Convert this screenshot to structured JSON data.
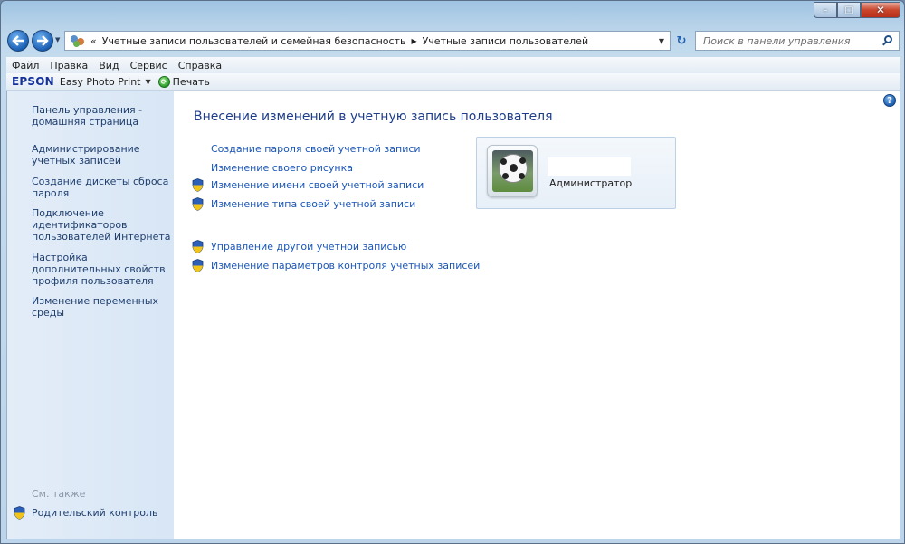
{
  "window": {
    "ghost_title": "",
    "colors": {
      "link": "#1a56b8",
      "heading": "#1e3e8b",
      "sidebar_bg": "#dde9f6",
      "frame": "#b9d4ea"
    }
  },
  "caption": {
    "minimize": "–",
    "maximize": "□",
    "close": "✕"
  },
  "navbar": {
    "back_icon": "arrow-left-icon",
    "forward_icon": "arrow-right-icon",
    "breadcrumb": {
      "prefix": "«",
      "items": [
        "Учетные записи пользователей и семейная безопасность",
        "Учетные записи пользователей"
      ]
    },
    "search_placeholder": "Поиск в панели управления"
  },
  "menubar": {
    "items": [
      "Файл",
      "Правка",
      "Вид",
      "Сервис",
      "Справка"
    ]
  },
  "toolbar": {
    "brand": "EPSON",
    "app": "Easy Photo Print",
    "print": "Печать"
  },
  "sidebar": {
    "links": [
      "Панель управления - домашняя страница",
      "Администрирование учетных записей",
      "Создание дискеты сброса пароля",
      "Подключение идентификаторов пользователей Интернета",
      "Настройка дополнительных свойств профиля пользователя",
      "Изменение переменных среды"
    ],
    "see_also": "См. также",
    "parental_control": "Родительский контроль"
  },
  "main": {
    "heading": "Внесение изменений в учетную запись пользователя",
    "tasks": [
      {
        "label": "Создание пароля своей учетной записи",
        "shield": false
      },
      {
        "label": "Изменение своего рисунка",
        "shield": false
      },
      {
        "label": "Изменение имени своей учетной записи",
        "shield": true
      },
      {
        "label": "Изменение типа своей учетной записи",
        "shield": true
      }
    ],
    "tasks2": [
      {
        "label": "Управление другой учетной записью",
        "shield": true
      },
      {
        "label": "Изменение параметров контроля учетных записей",
        "shield": true
      }
    ],
    "account": {
      "type": "Администратор",
      "picture": "soccer-ball-picture"
    }
  }
}
